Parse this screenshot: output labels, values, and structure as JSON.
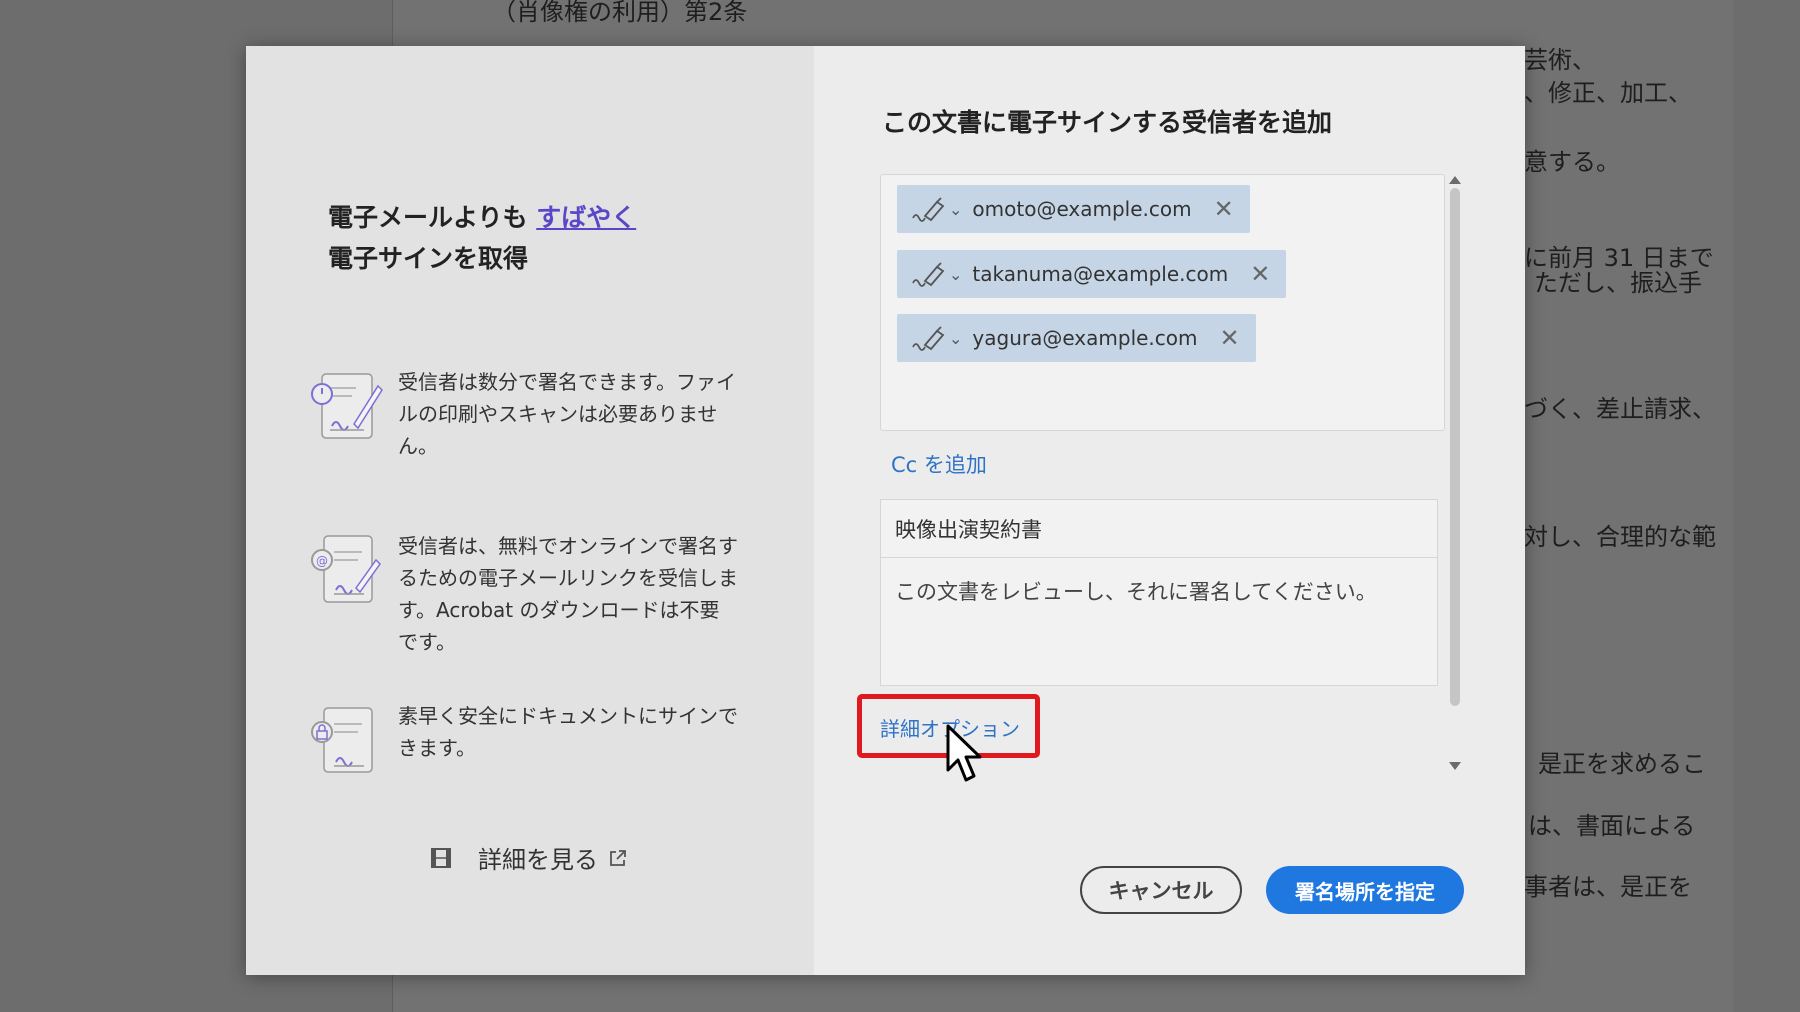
{
  "background_doc": {
    "lines": [
      "（肖像権の利用）第2条",
      "芸術、",
      "、修正、加工、",
      "意する。",
      "に前月 31 日まで",
      "ただし、振込手",
      "づく、差止請求、",
      "対し、合理的な範",
      "是正を求めるこ",
      "は、書面による",
      "事者は、是正を"
    ]
  },
  "left_panel": {
    "headline_prefix": "電子メールよりも ",
    "headline_link": "すばやく",
    "headline_line2": "電子サインを取得",
    "features": [
      {
        "icon": "sign-timer-icon",
        "text": "受信者は数分で署名できます。ファイルの印刷やスキャンは必要ありません。"
      },
      {
        "icon": "sign-email-icon",
        "text": "受信者は、無料でオンラインで署名するための電子メールリンクを受信します。Acrobat のダウンロードは不要です。"
      },
      {
        "icon": "sign-lock-icon",
        "text": "素早く安全にドキュメントにサインできます。"
      }
    ],
    "learn_more": "詳細を見る"
  },
  "right_panel": {
    "title": "この文書に電子サインする受信者を追加",
    "recipients": [
      {
        "email": "omoto@example.com"
      },
      {
        "email": "takanuma@example.com"
      },
      {
        "email": "yagura@example.com"
      }
    ],
    "add_cc": "Cc を追加",
    "subject": "映像出演契約書",
    "message": "この文書をレビューし、それに署名してください。",
    "advanced_options": "詳細オプション",
    "cancel_label": "キャンセル",
    "primary_label": "署名場所を指定"
  },
  "colors": {
    "accent": "#1f77e0",
    "link": "#2f73c6",
    "highlight": "#e0191e",
    "chip": "#c5d5e6"
  }
}
